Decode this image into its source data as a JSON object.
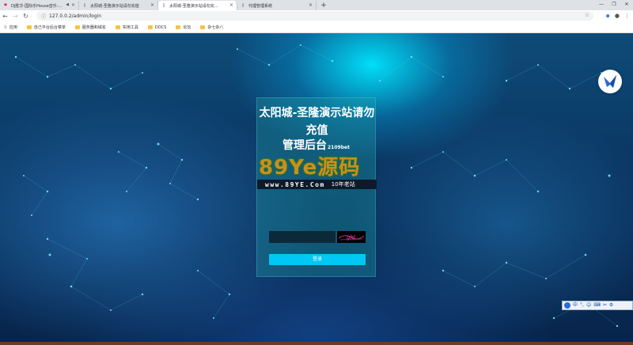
{
  "browser": {
    "tabs": [
      {
        "title": "DJ胜华-国际乐House音乐-…",
        "favicon": "heart",
        "audible": true,
        "active": false
      },
      {
        "title": "太阳城-圣隆演示站请勿充值",
        "favicon": "page",
        "audible": false,
        "active": false
      },
      {
        "title": "太阳城-圣隆演示站请勿充…",
        "favicon": "page",
        "audible": false,
        "active": true
      },
      {
        "title": "代理管理系统",
        "favicon": "page",
        "audible": false,
        "active": false
      }
    ],
    "url": "127.0.0.2/admin/login",
    "bookmarks": [
      {
        "label": "应用",
        "type": "apps"
      },
      {
        "label": "自己平台后台菜单",
        "type": "folder"
      },
      {
        "label": "服务器和域名",
        "type": "folder"
      },
      {
        "label": "实用工具",
        "type": "folder"
      },
      {
        "label": "DOCS",
        "type": "folder"
      },
      {
        "label": "论坛",
        "type": "folder"
      },
      {
        "label": "杂七杂八",
        "type": "folder"
      }
    ]
  },
  "login": {
    "title": "太阳城-圣隆演示站请勿充值",
    "subtitle": "管理后台",
    "subtitle_suffix": "2109bet",
    "watermark_main": "89Ye源码",
    "watermark_url": "www.89YE.Com",
    "watermark_tag": "10年老站",
    "captcha_placeholder": "",
    "captcha_text": "ghl",
    "login_button": "登录"
  },
  "ime": {
    "items": [
      "中",
      "°,",
      "☺",
      "⌨",
      "✂",
      "⚙"
    ]
  },
  "colors": {
    "button": "#00c8f5",
    "panel": "rgba(30,160,170,0.35)",
    "accent_glow": "#00e6ff"
  }
}
